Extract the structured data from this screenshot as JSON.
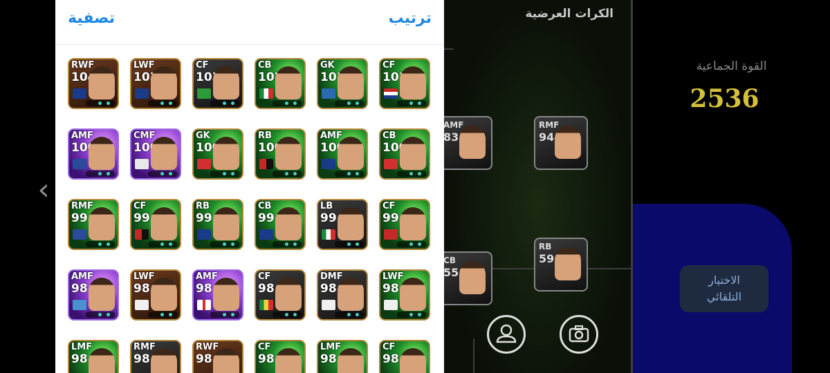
{
  "panel": {
    "filter_label": "تصفية",
    "sort_label": "ترتيب",
    "cards": [
      {
        "position": "RWF",
        "rating": "104"
      },
      {
        "position": "LWF",
        "rating": "103"
      },
      {
        "position": "CF",
        "rating": "103"
      },
      {
        "position": "CB",
        "rating": "102"
      },
      {
        "position": "GK",
        "rating": "101"
      },
      {
        "position": "CF",
        "rating": "101"
      },
      {
        "position": "AMF",
        "rating": "100"
      },
      {
        "position": "CMF",
        "rating": "100"
      },
      {
        "position": "GK",
        "rating": "100"
      },
      {
        "position": "RB",
        "rating": "100"
      },
      {
        "position": "AMF",
        "rating": "100"
      },
      {
        "position": "CB",
        "rating": "100"
      },
      {
        "position": "RMF",
        "rating": "99"
      },
      {
        "position": "CF",
        "rating": "99"
      },
      {
        "position": "RB",
        "rating": "99"
      },
      {
        "position": "CB",
        "rating": "99"
      },
      {
        "position": "LB",
        "rating": "99"
      },
      {
        "position": "CF",
        "rating": "99"
      },
      {
        "position": "AMF",
        "rating": "98"
      },
      {
        "position": "LWF",
        "rating": "98"
      },
      {
        "position": "AMF",
        "rating": "98"
      },
      {
        "position": "CF",
        "rating": "98"
      },
      {
        "position": "DMF",
        "rating": "98"
      },
      {
        "position": "LWF",
        "rating": "98"
      },
      {
        "position": "LMF",
        "rating": "98"
      },
      {
        "position": "RMF",
        "rating": "98"
      },
      {
        "position": "RWF",
        "rating": "98"
      },
      {
        "position": "CF",
        "rating": "98"
      },
      {
        "position": "LMF",
        "rating": "98"
      },
      {
        "position": "CF",
        "rating": "98"
      }
    ]
  },
  "field": {
    "title": "الكرات العرضية",
    "players": [
      {
        "position": "AMF",
        "rating": "83"
      },
      {
        "position": "RMF",
        "rating": "94"
      },
      {
        "position": "CB",
        "rating": "55"
      },
      {
        "position": "RB",
        "rating": "59"
      }
    ]
  },
  "team": {
    "strength_label": "القوة الجماعية",
    "strength_value": "2536",
    "auto_select_line1": "الاختيار",
    "auto_select_line2": "التلقائي"
  },
  "icons": {
    "back": "chevron-left-icon",
    "player": "person-icon",
    "camera": "camera-icon"
  },
  "colors": {
    "accent_blue": "#1e88e5",
    "strength_yellow": "#d3c13a"
  }
}
